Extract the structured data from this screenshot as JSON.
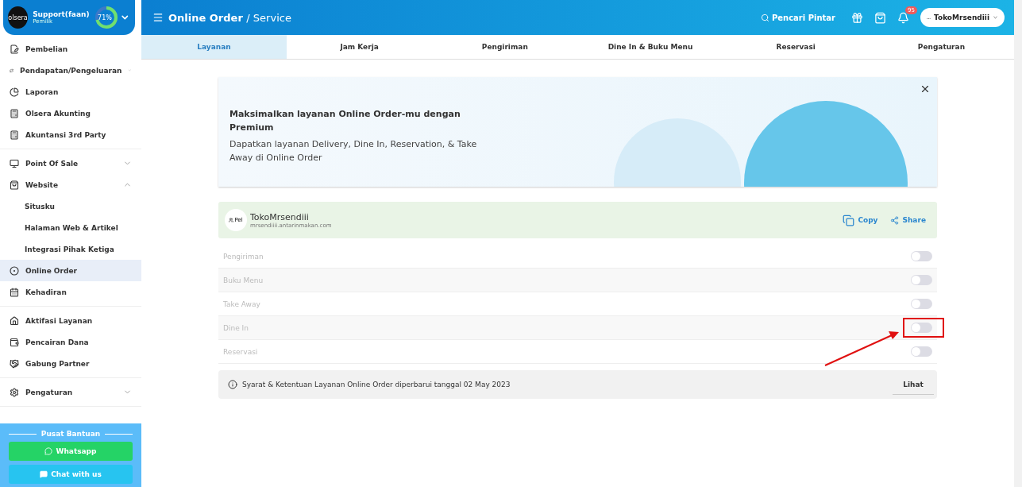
{
  "profile": {
    "logo": "olsera",
    "name": "Support(faan)",
    "role": "Pemilik",
    "progress": {
      "level": 0.71,
      "reading": "71%"
    }
  },
  "sidebar": {
    "groups": [
      {
        "items": [
          {
            "label": "Pembelian",
            "selected": false
          },
          {
            "label": "Pendapatan/Pengeluaran",
            "selected": false,
            "expanded": false
          },
          {
            "label": "Laporan",
            "selected": false
          },
          {
            "label": "Olsera Akunting",
            "selected": false
          },
          {
            "label": "Akuntansi 3rd Party",
            "selected": false
          }
        ]
      },
      {
        "items": [
          {
            "label": "Point Of Sale",
            "selected": false,
            "expanded": false
          },
          {
            "label": "Website",
            "selected": false,
            "expanded": true,
            "children": [
              {
                "label": "Situsku",
                "selected": false
              },
              {
                "label": "Halaman Web & Artikel",
                "selected": false
              },
              {
                "label": "Integrasi Pihak Ketiga",
                "selected": false
              }
            ]
          },
          {
            "label": "Online Order",
            "selected": true
          },
          {
            "label": "Kehadiran",
            "selected": false
          }
        ]
      },
      {
        "items": [
          {
            "label": "Aktifasi Layanan",
            "selected": false
          },
          {
            "label": "Pencairan Dana",
            "selected": false
          },
          {
            "label": "Gabung Partner",
            "selected": false
          }
        ]
      },
      {
        "items": [
          {
            "label": "Pengaturan",
            "selected": false,
            "expanded": false
          }
        ]
      }
    ],
    "help": {
      "title": "Pusat Bantuan",
      "buttons": [
        {
          "kind": "whatsapp",
          "label": "Whatsapp"
        },
        {
          "kind": "chat",
          "label": "Chat with us"
        }
      ]
    }
  },
  "topbar": {
    "title": "Online Order",
    "subtitle": "/ Service",
    "search": "Pencari Pintar",
    "notifications": "95",
    "store": {
      "avatar": "…",
      "name": "TokoMrsendiii"
    }
  },
  "tabs": [
    {
      "label": "Layanan",
      "selected": true
    },
    {
      "label": "Jam Kerja",
      "selected": false
    },
    {
      "label": "Pengiriman",
      "selected": false
    },
    {
      "label": "Dine In & Buku Menu",
      "selected": false
    },
    {
      "label": "Reservasi",
      "selected": false
    },
    {
      "label": "Pengaturan",
      "selected": false
    }
  ],
  "banner": {
    "title": "Maksimalkan layanan Online Order-mu dengan Premium",
    "text": "Dapatkan layanan Delivery, Dine In, Reservation, & Take Away di Online Order"
  },
  "store_card": {
    "avatar": "Pel",
    "name": "TokoMrsendiii",
    "url": "mrsendiiii.antarinmakan.com",
    "actions": [
      "Copy",
      "Share"
    ]
  },
  "services": [
    {
      "label": "Pengiriman",
      "on": false,
      "highlighted": false
    },
    {
      "label": "Buku Menu",
      "on": false,
      "highlighted": false
    },
    {
      "label": "Take Away",
      "on": false,
      "highlighted": false
    },
    {
      "label": "Dine In",
      "on": false,
      "highlighted": true
    },
    {
      "label": "Reservasi",
      "on": false,
      "highlighted": false
    }
  ],
  "terms": {
    "text": "Syarat & Ketentuan Layanan Online Order diperbarui tanggal 02 May 2023",
    "button": "Lihat"
  }
}
